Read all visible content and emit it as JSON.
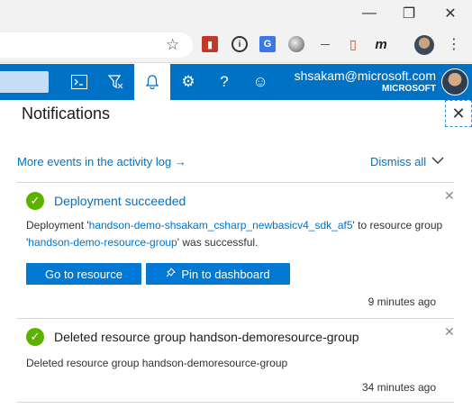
{
  "browser": {
    "window_controls": {
      "minimize": "—",
      "maximize": "❐",
      "close": "✕"
    },
    "bookmark_icon": "star-icon",
    "extensions": [
      "book-icon",
      "circle-i-icon",
      "translate-icon",
      "marble-icon",
      "dash-icon",
      "office-icon",
      "m-icon"
    ],
    "extension_glyphs": {
      "ext1": "▮",
      "ext2": "i",
      "ext3": "G",
      "ext4": "",
      "ext5": "—",
      "ext6": "▯",
      "ext7": "m"
    },
    "menu": "⋮"
  },
  "portal": {
    "toolbar_icons": {
      "shell": "⌨",
      "filter": "⊞",
      "bell": "🔔",
      "settings": "⚙",
      "help": "?",
      "feedback": "☺"
    },
    "user_email": "shsakam@microsoft.com",
    "tenant": "MICROSOFT",
    "accent_color": "#0072c6"
  },
  "notifications": {
    "title": "Notifications",
    "close_glyph": "✕",
    "activity_link": "More events in the activity log →",
    "dismiss_all": "Dismiss all",
    "dismiss_chevron": "⌄",
    "items": [
      {
        "title": "Deployment succeeded",
        "body_prefix": "Deployment '",
        "deployment_name": "handson-demo-shsakam_csharp_newbasicv4_sdk_af5",
        "body_mid": "' to resource group '",
        "resource_group": "handson-demo-resource-group",
        "body_suffix": "' was successful.",
        "primary_button": "Go to resource",
        "secondary_button": "Pin to dashboard",
        "time": "9 minutes ago",
        "dismiss": "✕",
        "status": "success"
      },
      {
        "title": "Deleted resource group handson-demoresource-group",
        "body": "Deleted resource group handson-demoresource-group",
        "time": "34 minutes ago",
        "dismiss": "✕",
        "status": "success"
      }
    ]
  }
}
